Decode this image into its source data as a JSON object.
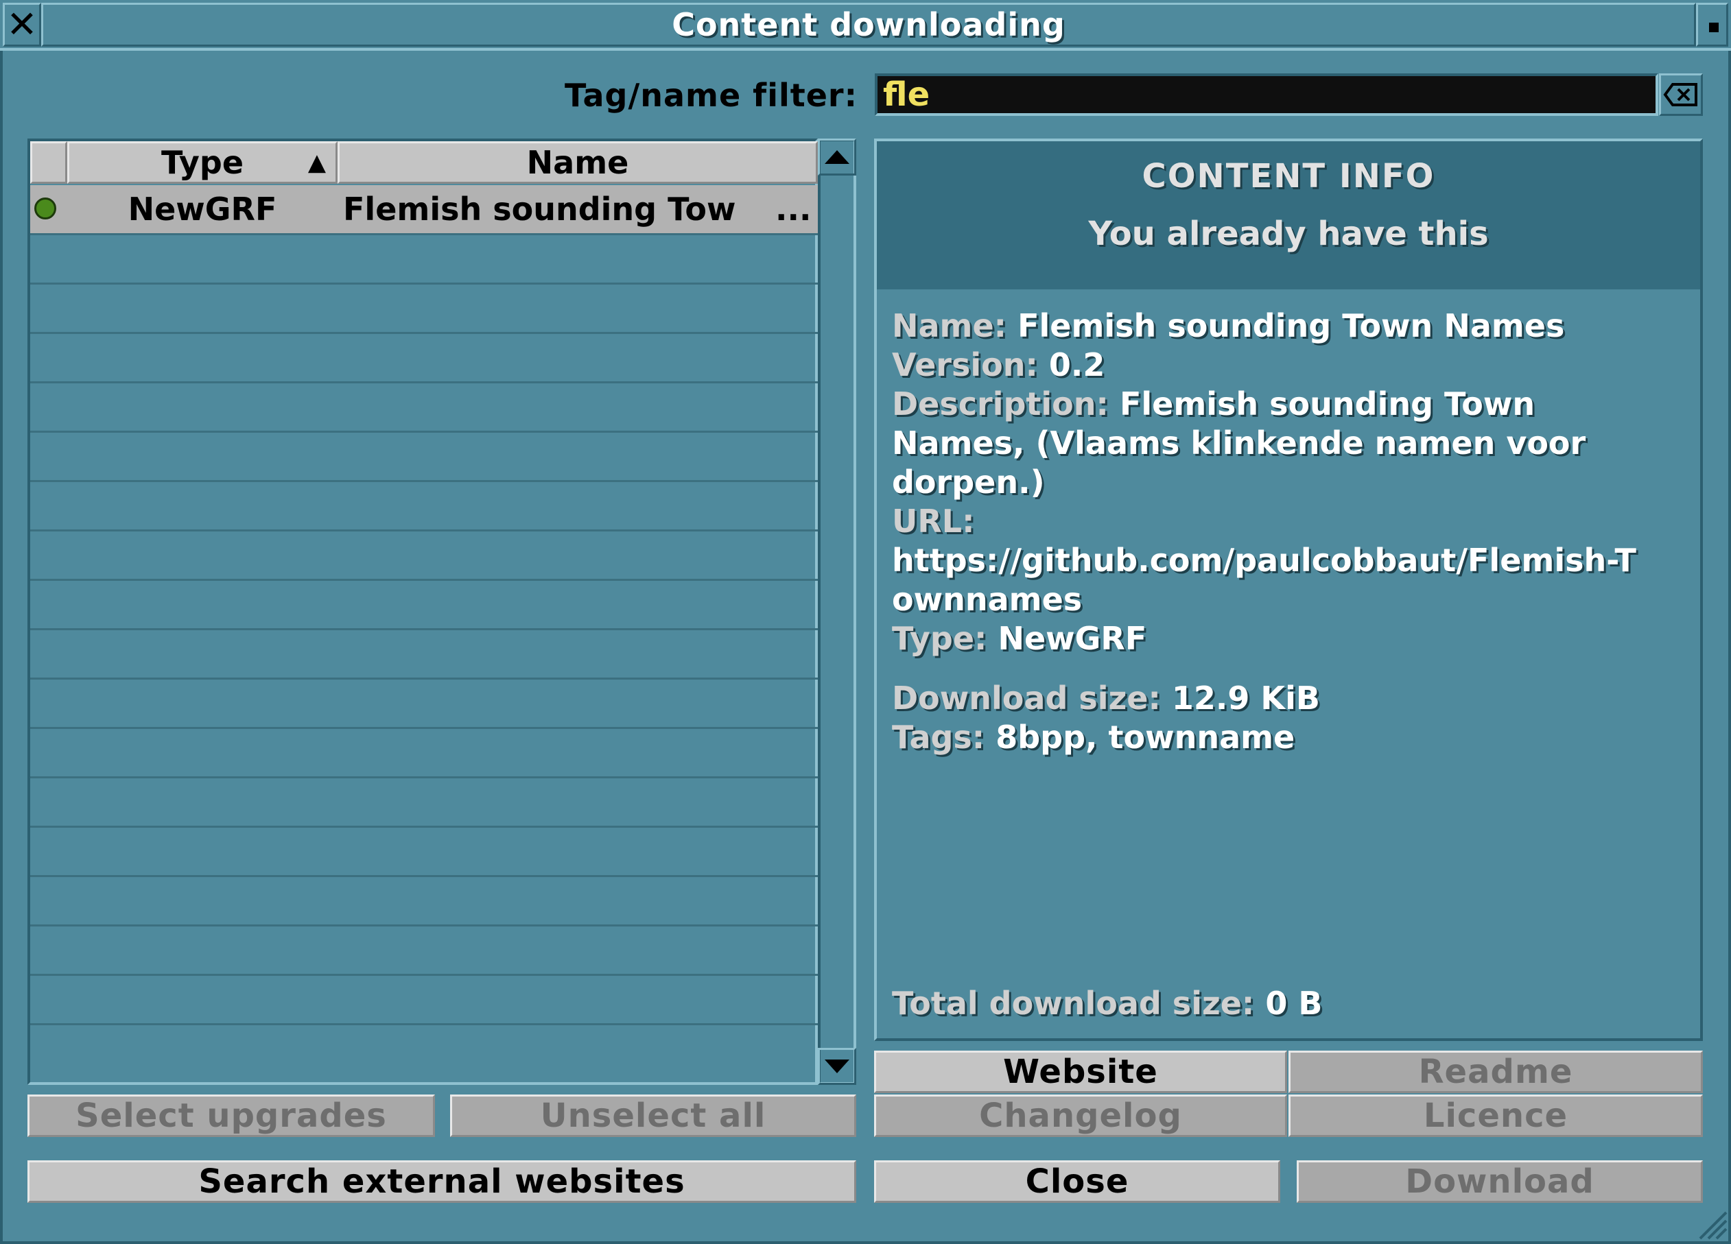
{
  "window": {
    "title": "Content downloading",
    "close_glyph": "✕",
    "colors": {
      "background": "#4f8a9d",
      "header": "#356d80",
      "input_text": "#f0e060",
      "status_dot": "#4a8a1c"
    }
  },
  "filter": {
    "label": "Tag/name filter:",
    "value": "fle",
    "clear_icon": "backspace-icon"
  },
  "list": {
    "columns": {
      "type": "Type",
      "name": "Name",
      "sort_indicator": "▲"
    },
    "rows": [
      {
        "status": "selected",
        "type": "NewGRF",
        "name": "Flemish sounding Tow",
        "ellipsis": "..."
      }
    ]
  },
  "info": {
    "title": "CONTENT INFO",
    "status": "You already have this",
    "name_label": "Name:",
    "name_value": "Flemish sounding Town Names",
    "version_label": "Version:",
    "version_value": "0.2",
    "description_label": "Description:",
    "description_line1": "Flemish sounding Town",
    "description_line2": "Names, (Vlaams klinkende namen voor",
    "description_line3": "dorpen.)",
    "url_label": "URL:",
    "url_line1": "https://github.com/paulcobbaut/Flemish-T",
    "url_line2": "ownnames",
    "type_label": "Type:",
    "type_value": "NewGRF",
    "size_label": "Download size:",
    "size_value": "12.9 KiB",
    "tags_label": "Tags:",
    "tags_value": "8bpp, townname",
    "total_label": "Total download size:",
    "total_value": "0 B"
  },
  "buttons": {
    "select_upgrades": "Select upgrades",
    "unselect_all": "Unselect all",
    "search_external": "Search external websites",
    "website": "Website",
    "readme": "Readme",
    "changelog": "Changelog",
    "licence": "Licence",
    "close": "Close",
    "download": "Download"
  }
}
